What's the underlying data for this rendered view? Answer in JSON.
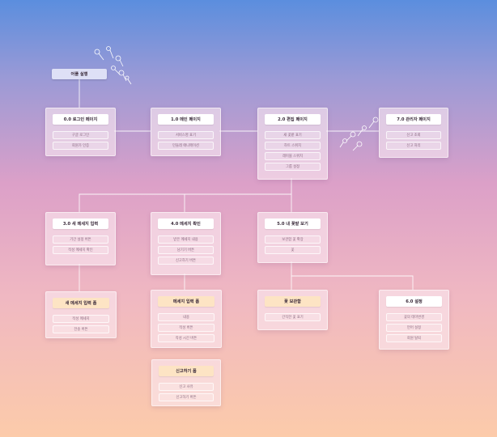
{
  "start": {
    "label": "어플 실행"
  },
  "nodes": {
    "n0": {
      "title": "0.0 로그인 페이지",
      "items": [
        "구글 로그인",
        "회원가 인증"
      ]
    },
    "n1": {
      "title": "1.0 메인 페이지",
      "items": [
        "서비스명 표기",
        "민들레 애니메이션"
      ]
    },
    "n2": {
      "title": "2.0 편집 페이지",
      "items": [
        "새 꽃밭 표기",
        "하트 스위치",
        "레이블 스위치",
        "그룹 설정"
      ]
    },
    "n7": {
      "title": "7.0 관리자 페이지",
      "items": [
        "신고 조회",
        "신고 처리"
      ]
    },
    "n3": {
      "title": "3.0 새 메세지 입력",
      "items": [
        "기간 설정 버튼",
        "작성 메세지 확인"
      ]
    },
    "n4": {
      "title": "4.0 메세지 확인",
      "items": [
        "받은 메세지 내용",
        "남기기 버튼",
        "신고하기 버튼"
      ]
    },
    "n5": {
      "title": "5.0 내 꽃밭 보기",
      "items": [
        "보관함 꽃 확장",
        "꽃"
      ]
    },
    "f1": {
      "title": "새 메세지 입력 폼",
      "items": [
        "작성 메세지",
        "전송 버튼"
      ]
    },
    "f2": {
      "title": "메세지 입력 폼",
      "items": [
        "내용",
        "작성 버튼",
        "작성 시간 버튼"
      ]
    },
    "f3": {
      "title": "꽃 보관함",
      "items": [
        "간직한 꽃 표기"
      ]
    },
    "n6": {
      "title": "6.0 설정",
      "items": [
        "꽃의 테마변경",
        "언어 설정",
        "회원 탈퇴"
      ]
    },
    "f4": {
      "title": "신고하기 폼",
      "items": [
        "신고 사유",
        "신고하기 버튼"
      ]
    }
  },
  "colors": {
    "line": "#ffffff",
    "title_bg": "#ffffff",
    "form_title_bg": "#fde4c4"
  },
  "decorations": [
    "dandelion-seeds-icon"
  ]
}
